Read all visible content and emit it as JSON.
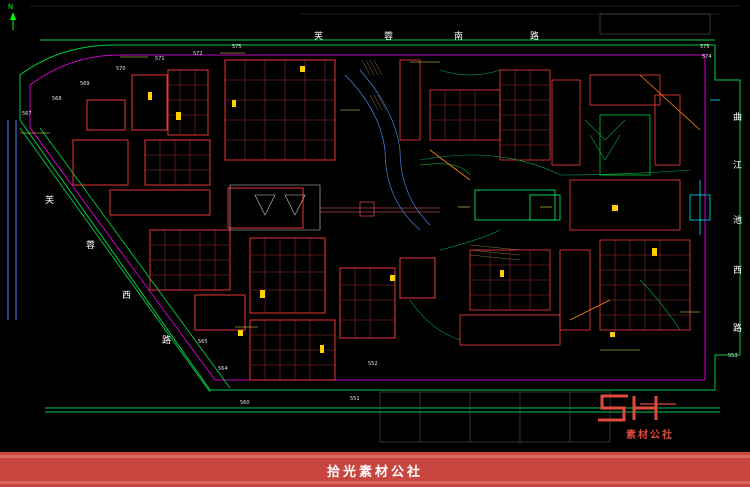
{
  "north_label": "N",
  "streets": {
    "top": [
      "芙",
      "蓉",
      "南",
      "路"
    ],
    "left": [
      "芙",
      "蓉",
      "西",
      "路"
    ],
    "right": [
      "曲",
      "江",
      "池",
      "西",
      "路"
    ]
  },
  "elevation_marks": [
    "575",
    "574",
    "572",
    "571",
    "570",
    "569",
    "568",
    "567",
    "565",
    "564",
    "560",
    "551",
    "552",
    "553"
  ],
  "logo": {
    "letters": "SH",
    "sub": "素材公社"
  },
  "footer": {
    "text": "拾光素材公社"
  },
  "colors": {
    "background": "#000000",
    "footer": "#c9453f",
    "logo": "#e04a3c"
  }
}
